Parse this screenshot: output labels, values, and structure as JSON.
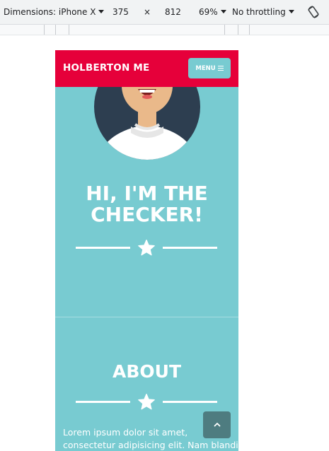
{
  "devtools": {
    "dimensions_label": "Dimensions: iPhone X",
    "width": "375",
    "times": "×",
    "height": "812",
    "zoom": "69%",
    "throttling": "No throttling"
  },
  "page": {
    "brand": "HOLBERTON ME",
    "menu_label": "MENU",
    "hero_title_line1": "HI, I'M THE",
    "hero_title_line2": "CHECKER!",
    "about_title": "ABOUT",
    "about_text_line1": "Lorem ipsum dolor sit amet,",
    "about_text_line2": "consectetur adipisicing elit. Nam blandit"
  },
  "colors": {
    "navbar": "#e6003a",
    "teal": "#78cbd1",
    "scroll_button": "#4e7c80"
  },
  "icons": {
    "menu": "hamburger-icon",
    "star": "star-icon",
    "scroll_top": "chevron-up-icon",
    "rotate": "rotate-device-icon"
  }
}
